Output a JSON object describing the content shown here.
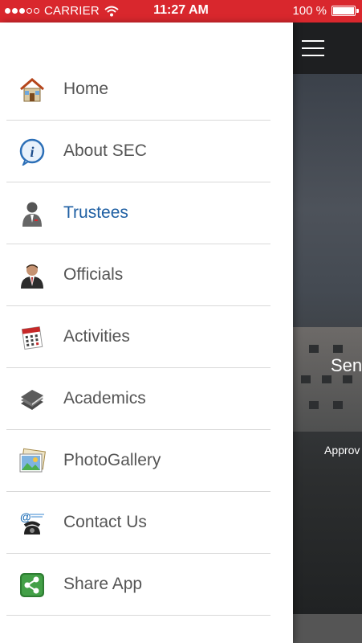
{
  "status_bar": {
    "carrier": "CARRIER",
    "time": "11:27 AM",
    "battery": "100 %"
  },
  "main": {
    "hero_title": "Sen",
    "hero_subtitle": "Approv"
  },
  "menu": {
    "active": "Trustees",
    "items": [
      {
        "label": "Home",
        "icon": "home-icon"
      },
      {
        "label": "About SEC",
        "icon": "info-icon"
      },
      {
        "label": "Trustees",
        "icon": "trustee-person-icon"
      },
      {
        "label": "Officials",
        "icon": "official-person-icon"
      },
      {
        "label": "Activities",
        "icon": "calendar-icon"
      },
      {
        "label": "Academics",
        "icon": "books-icon"
      },
      {
        "label": "PhotoGallery",
        "icon": "photo-gallery-icon"
      },
      {
        "label": "Contact Us",
        "icon": "contact-phone-icon"
      },
      {
        "label": "Share App",
        "icon": "share-icon"
      }
    ]
  }
}
